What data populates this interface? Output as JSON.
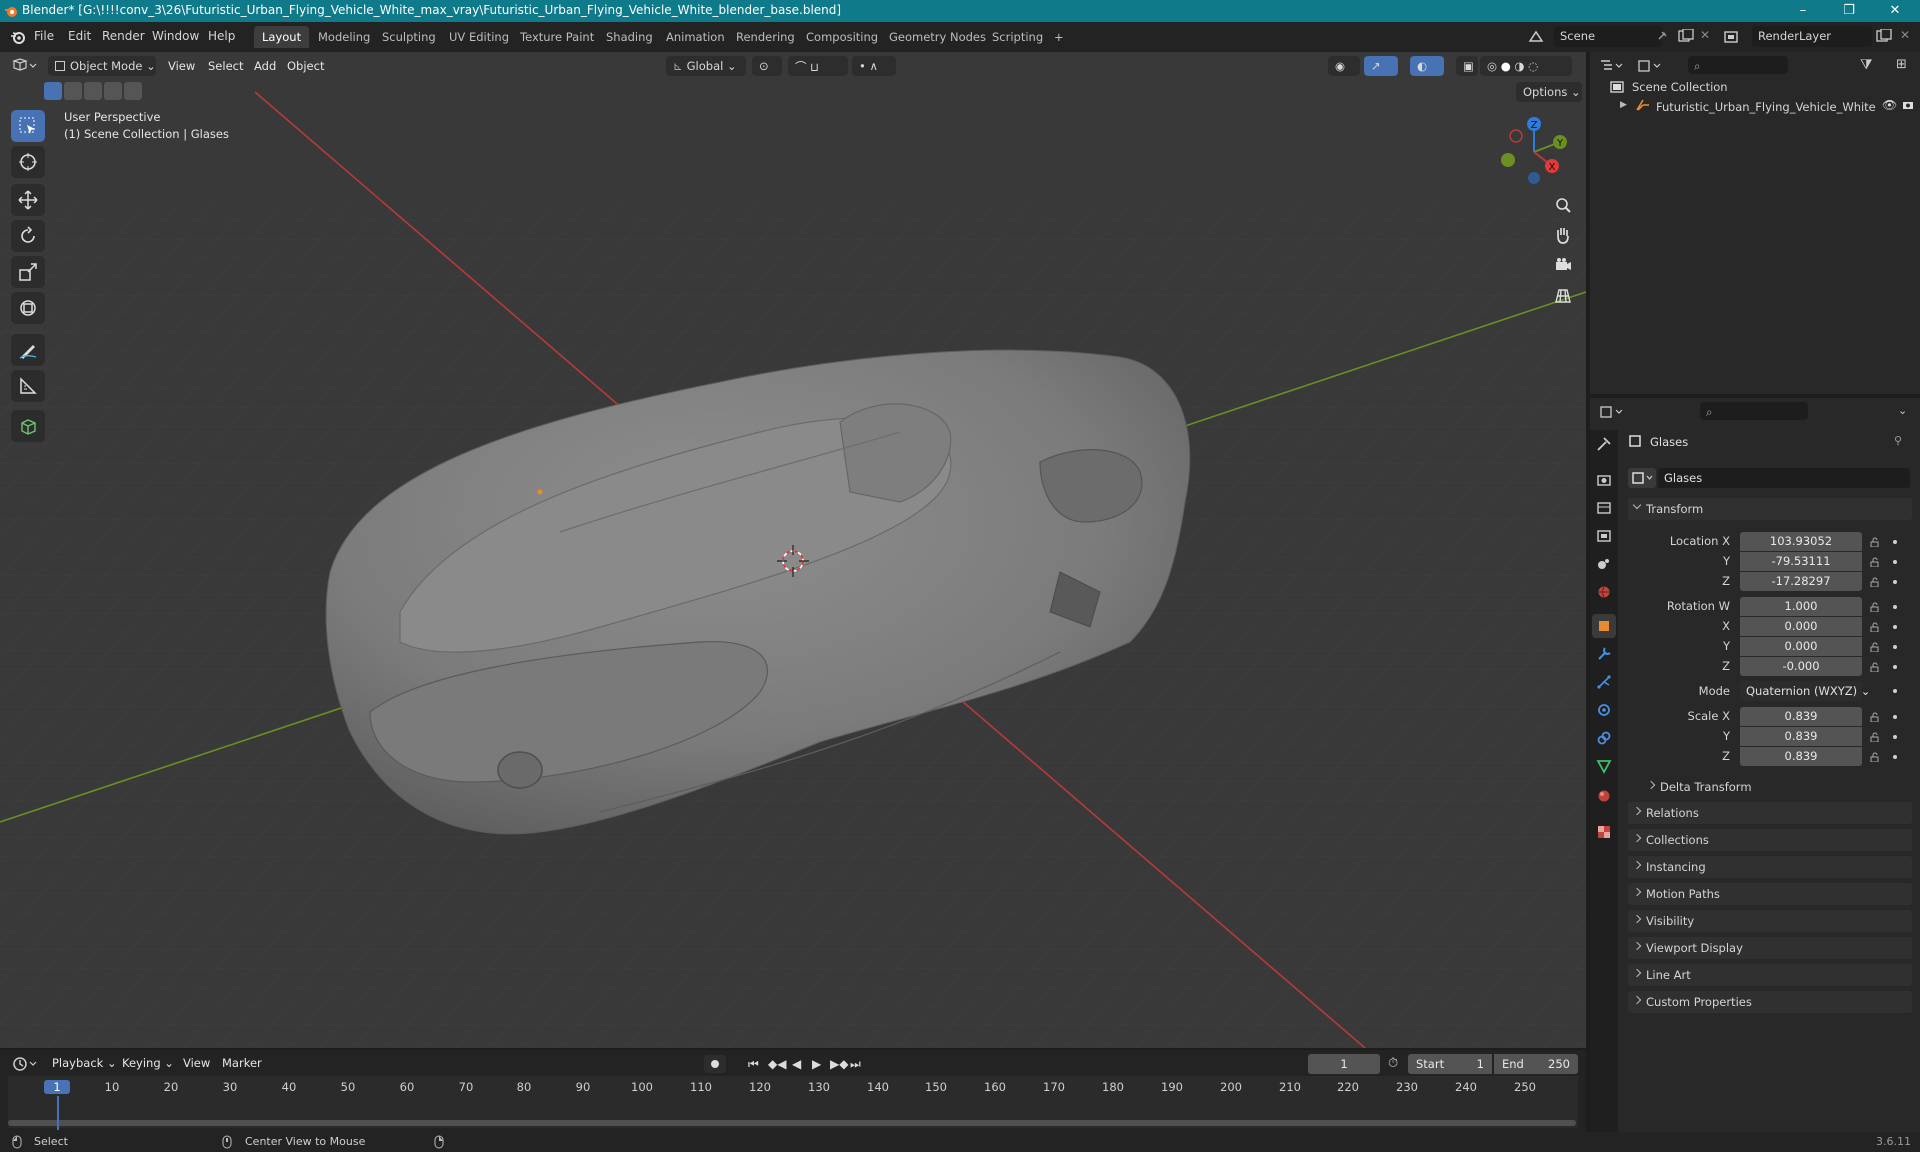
{
  "window": {
    "title": "Blender* [G:\\!!!!conv_3\\26\\Futuristic_Urban_Flying_Vehicle_White_max_vray\\Futuristic_Urban_Flying_Vehicle_White_blender_base.blend]",
    "min": "–",
    "max": "❐",
    "close": "✕"
  },
  "menus": [
    "File",
    "Edit",
    "Render",
    "Window",
    "Help"
  ],
  "workspaces": [
    {
      "label": "Layout",
      "active": true
    },
    {
      "label": "Modeling"
    },
    {
      "label": "Sculpting"
    },
    {
      "label": "UV Editing"
    },
    {
      "label": "Texture Paint"
    },
    {
      "label": "Shading"
    },
    {
      "label": "Animation"
    },
    {
      "label": "Rendering"
    },
    {
      "label": "Compositing"
    },
    {
      "label": "Geometry Nodes"
    },
    {
      "label": "Scripting"
    },
    {
      "label": "+"
    }
  ],
  "scene": {
    "name": "Scene",
    "render_layer": "RenderLayer"
  },
  "viewport": {
    "mode": "Object Mode",
    "menus": [
      "View",
      "Select",
      "Add",
      "Object"
    ],
    "orientation": "Global",
    "options": "Options",
    "perspective": "User Perspective",
    "collection_info": "(1) Scene Collection | Glases",
    "gizmo": {
      "z": "Z",
      "y": "Y",
      "x": "X"
    }
  },
  "outliner": {
    "root": "Scene Collection",
    "items": [
      "Futuristic_Urban_Flying_Vehicle_White"
    ]
  },
  "properties": {
    "object_name": "Glases",
    "datablock_name": "Glases",
    "transform": {
      "title": "Transform",
      "location_label": "Location X",
      "location": [
        "103.93052",
        "-79.53111",
        "-17.28297"
      ],
      "rotation_label": "Rotation W",
      "rotation": [
        "1.000",
        "0.000",
        "0.000",
        "-0.000"
      ],
      "mode_label": "Mode",
      "mode": "Quaternion (WXYZ)",
      "scale_label": "Scale X",
      "scale": [
        "0.839",
        "0.839",
        "0.839"
      ],
      "axis_y": "Y",
      "axis_z": "Z",
      "axis_x": "X",
      "delta": "Delta Transform"
    },
    "sections": [
      "Relations",
      "Collections",
      "Instancing",
      "Motion Paths",
      "Visibility",
      "Viewport Display",
      "Line Art",
      "Custom Properties"
    ]
  },
  "timeline": {
    "menus": [
      "Playback",
      "Keying",
      "View",
      "Marker"
    ],
    "current_frame": "1",
    "start_label": "Start",
    "start": "1",
    "end_label": "End",
    "end": "250",
    "ruler": [
      "1",
      "10",
      "20",
      "30",
      "40",
      "50",
      "60",
      "70",
      "80",
      "90",
      "100",
      "110",
      "120",
      "130",
      "140",
      "150",
      "160",
      "170",
      "180",
      "190",
      "200",
      "210",
      "220",
      "230",
      "240",
      "250"
    ]
  },
  "status": {
    "select": "Select",
    "center": "Center View to Mouse",
    "version": "3.6.11"
  },
  "colors": {
    "accent": "#4772b3",
    "titlebar": "#0f7a8a",
    "x_axis": "#b83a3a",
    "y_axis": "#6a8f23",
    "z_axis": "#2d7de0"
  }
}
